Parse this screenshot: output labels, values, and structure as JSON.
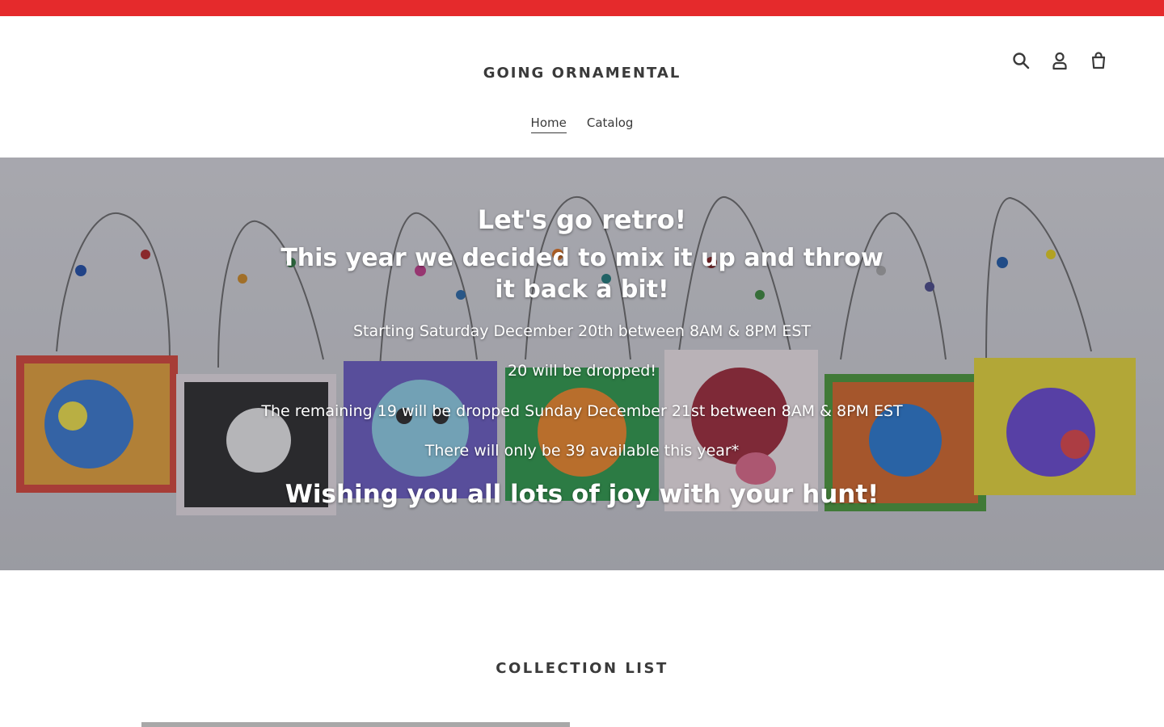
{
  "colors": {
    "announcement_bar": "#e52a2c",
    "text": "#3a3a3a",
    "hero_text": "#ffffff"
  },
  "header": {
    "logo": "GOING ORNAMENTAL",
    "icons": [
      "search-icon",
      "account-icon",
      "cart-icon"
    ],
    "nav": [
      {
        "label": "Home",
        "active": true
      },
      {
        "label": "Catalog",
        "active": false
      }
    ]
  },
  "hero": {
    "heading": "Let's go retro!",
    "subheading": "This year we decided to mix it up and throw it back a bit!",
    "lines": [
      "Starting Saturday December 20th between 8AM & 8PM EST",
      "20 will be dropped!",
      "The remaining 19 will be dropped Sunday December 21st between 8AM & 8PM EST",
      "There will only be 39 available this year*"
    ],
    "closing": "Wishing you all lots of joy with your hunt!"
  },
  "collection": {
    "title": "COLLECTION LIST"
  }
}
